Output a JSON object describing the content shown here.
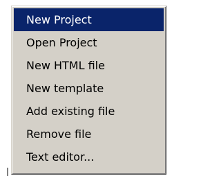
{
  "menu": {
    "items": [
      {
        "label": "New Project",
        "selected": true
      },
      {
        "label": "Open Project",
        "selected": false
      },
      {
        "label": "New HTML file",
        "selected": false
      },
      {
        "label": "New template",
        "selected": false
      },
      {
        "label": "Add existing file",
        "selected": false
      },
      {
        "label": "Remove file",
        "selected": false
      },
      {
        "label": "Text editor...",
        "selected": false
      }
    ]
  },
  "colors": {
    "menu_background": "#d4d0c8",
    "selection_background": "#0a246a",
    "selection_text": "#ffffff",
    "text": "#000000"
  }
}
